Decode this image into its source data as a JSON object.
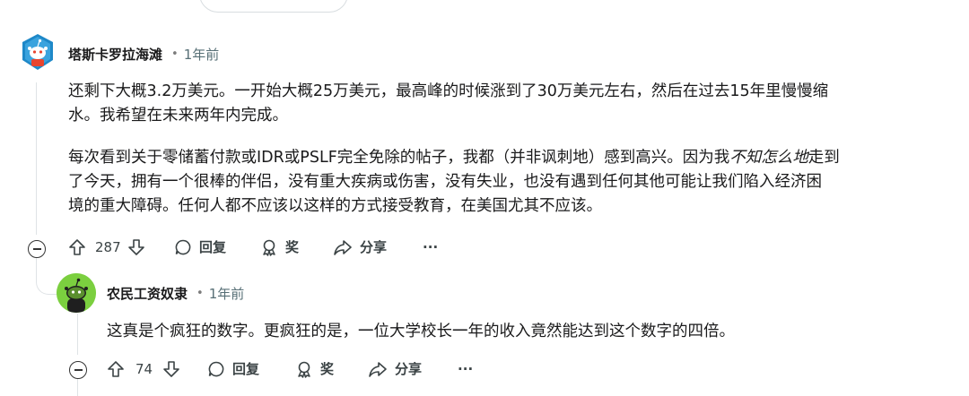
{
  "comment1": {
    "username": "塔斯卡罗拉海滩",
    "time": "1年前",
    "para1_line1": "还剩下大概3.2万美元。一开始大概25万美元，最高峰的时候涨到了30万美元左右，然后在过去15年里慢慢缩",
    "para1_line2": "水。我希望在未来两年内完成。",
    "para2_line1_a": "每次看到关于零储蓄付款或IDR或PSLF完全免除的帖子，我都（并非讽刺地）感到高兴。因为我",
    "para2_line1_em": "不知怎么地",
    "para2_line1_b": "走到",
    "para2_line2": "了今天，拥有一个很棒的伴侣，没有重大疾病或伤害，没有失业，也没有遇到任何其他可能让我们陷入经济困",
    "para2_line3": "境的重大障碍。任何人都不应该以这样的方式接受教育，在美国尤其不应该。",
    "votes": "287",
    "reply": "回复",
    "award": "奖",
    "share": "分享",
    "more": "···"
  },
  "comment2": {
    "username": "农民工资奴隶",
    "time": "1年前",
    "text": "这真是个疯狂的数字。更疯狂的是，一位大学校长一年的收入竟然能达到这个数字的四倍。",
    "votes": "74",
    "reply": "回复",
    "award": "奖",
    "share": "分享",
    "more": "···"
  },
  "colors": {
    "avatar1_bg": "#1e88c8",
    "avatar2_bg": "#7bcf3f",
    "text": "#1a1a1b",
    "meta": "#576f76"
  }
}
